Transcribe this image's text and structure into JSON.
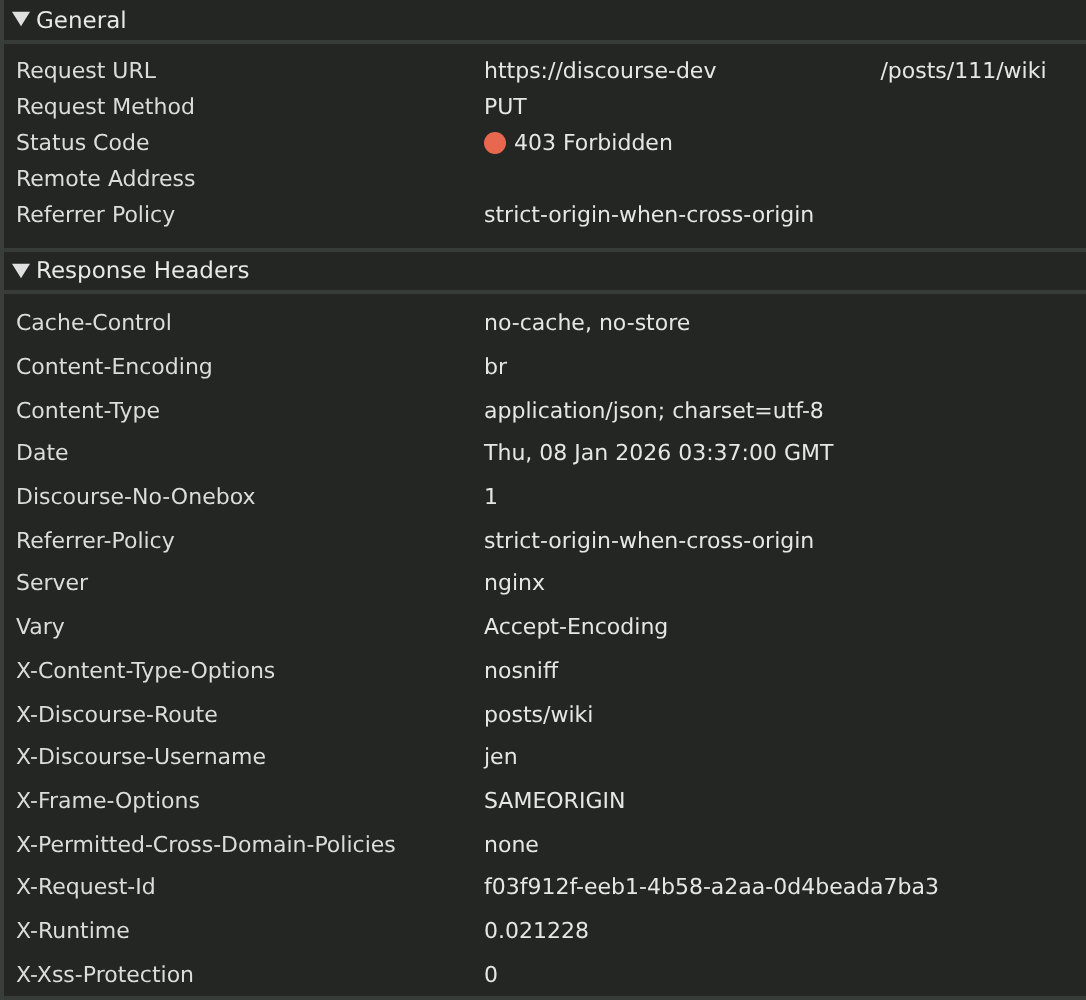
{
  "sections": [
    {
      "title": "General",
      "expanded": true,
      "compact": true,
      "rows": [
        {
          "name": "Request URL",
          "value": "https://discourse-dev",
          "value_tail": "/posts/111/wiki"
        },
        {
          "name": "Request Method",
          "value": "PUT"
        },
        {
          "name": "Status Code",
          "value": "403 Forbidden",
          "color": "#e8674f"
        },
        {
          "name": "Remote Address"
        },
        {
          "name": "Referrer Policy",
          "value": "strict-origin-when-cross-origin"
        }
      ]
    },
    {
      "title": "Response Headers",
      "expanded": true,
      "compact": false,
      "rows": [
        {
          "name": "Cache-Control",
          "value": "no-cache, no-store"
        },
        {
          "name": "Content-Encoding",
          "value": "br"
        },
        {
          "name": "Content-Type",
          "value": "application/json; charset=utf-8"
        },
        {
          "name": "Date",
          "value": "Thu, 08 Jan 2026 03:37:00 GMT"
        },
        {
          "name": "Discourse-No-Onebox",
          "value": "1"
        },
        {
          "name": "Referrer-Policy",
          "value": "strict-origin-when-cross-origin"
        },
        {
          "name": "Server",
          "value": "nginx"
        },
        {
          "name": "Vary",
          "value": "Accept-Encoding"
        },
        {
          "name": "X-Content-Type-Options",
          "value": "nosniff"
        },
        {
          "name": "X-Discourse-Route",
          "value": "posts/wiki"
        },
        {
          "name": "X-Discourse-Username",
          "value": "jen"
        },
        {
          "name": "X-Frame-Options",
          "value": "SAMEORIGIN"
        },
        {
          "name": "X-Permitted-Cross-Domain-Policies",
          "value": "none"
        },
        {
          "name": "X-Request-Id",
          "value": "f03f912f-eeb1-4b58-a2aa-0d4beada7ba3"
        },
        {
          "name": "X-Runtime",
          "value": "0.021228"
        },
        {
          "name": "X-Xss-Protection",
          "value": "0"
        }
      ]
    }
  ]
}
